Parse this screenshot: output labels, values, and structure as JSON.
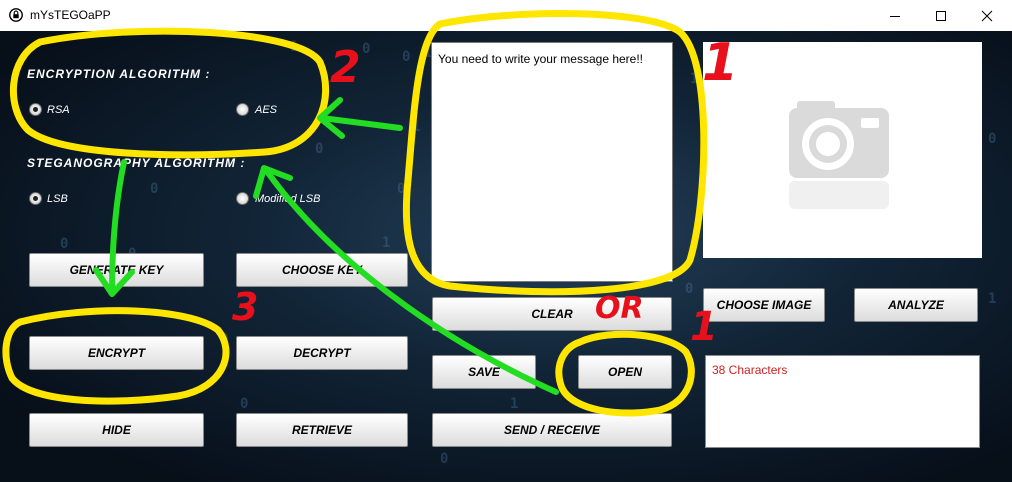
{
  "window": {
    "title": "mYsTEGOaPP"
  },
  "encryption": {
    "label": "ENCRYPTION ALGORITHM :",
    "options": [
      {
        "label": "RSA",
        "checked": true
      },
      {
        "label": "AES",
        "checked": false
      }
    ]
  },
  "steganography": {
    "label": "STEGANOGRAPHY ALGORITHM :",
    "options": [
      {
        "label": "LSB",
        "checked": true
      },
      {
        "label": "Modified LSB",
        "checked": false
      }
    ]
  },
  "buttons": {
    "generate_key": "GENERATE KEY",
    "choose_key": "CHOOSE KEY",
    "encrypt": "ENCRYPT",
    "decrypt": "DECRYPT",
    "hide": "HIDE",
    "retrieve": "RETRIEVE",
    "clear": "CLEAR",
    "save": "SAVE",
    "open": "OPEN",
    "send_receive": "SEND / RECEIVE",
    "choose_image": "CHOOSE IMAGE",
    "analyze": "ANALYZE"
  },
  "message": {
    "text": "You need to write your message here!!"
  },
  "info": {
    "text": "38 Characters"
  },
  "annotations": {
    "n1": "1",
    "n2": "2",
    "n3": "3",
    "or": "OR",
    "n1b": "1"
  },
  "colors": {
    "highlight": "#ffe600",
    "arrow": "#22dd22",
    "ink": "#e8101a"
  }
}
